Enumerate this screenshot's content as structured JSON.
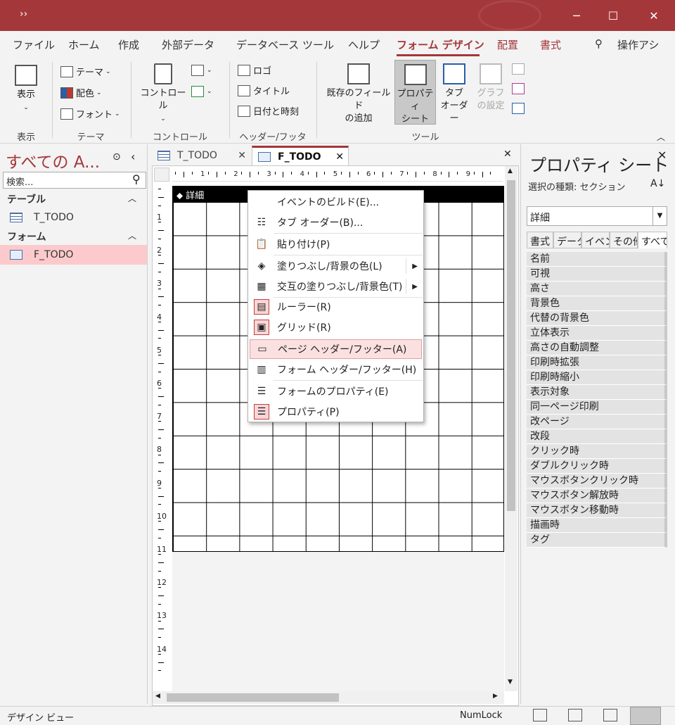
{
  "titlebar": {
    "quick_access": "››",
    "minimize": "─",
    "maximize": "☐",
    "close": "✕"
  },
  "menu": {
    "tabs": [
      "ファイル",
      "ホーム",
      "作成",
      "外部データ",
      "データベース ツール",
      "ヘルプ",
      "フォーム デザイン",
      "配置",
      "書式"
    ],
    "search_label": "操作アシ"
  },
  "ribbon": {
    "view": {
      "label": "表示",
      "group": "表示"
    },
    "theme": {
      "theme": "テーマ",
      "color": "配色",
      "font": "フォント",
      "group": "テーマ"
    },
    "controls": {
      "label": "コントロール",
      "group": "コントロール"
    },
    "header_footer": {
      "logo": "ロゴ",
      "title": "タイトル",
      "datetime": "日付と時刻",
      "group": "ヘッダー/フッター"
    },
    "tools": {
      "existing_fields_1": "既存のフィールド",
      "existing_fields_2": "の追加",
      "property_sheet_1": "プロパティ",
      "property_sheet_2": "シート",
      "tab_order_1": "タブ",
      "tab_order_2": "オーダー",
      "chart_settings_1": "グラフ",
      "chart_settings_2": "の設定",
      "group": "ツール"
    }
  },
  "nav": {
    "title": "すべての A...",
    "search_placeholder": "検索...",
    "tables_header": "テーブル",
    "tables": [
      "T_TODO"
    ],
    "forms_header": "フォーム",
    "forms": [
      "F_TODO"
    ]
  },
  "doc_tabs": [
    {
      "label": "T_TODO",
      "active": false
    },
    {
      "label": "F_TODO",
      "active": true
    }
  ],
  "design": {
    "section_label": "詳細",
    "hruler": [
      "1",
      "2",
      "3",
      "4",
      "5",
      "6",
      "7",
      "8",
      "9"
    ],
    "vruler": [
      "1",
      "2",
      "3",
      "4",
      "5",
      "6",
      "7",
      "8",
      "9",
      "10",
      "11",
      "12",
      "13",
      "14"
    ]
  },
  "context_menu": {
    "items": [
      "イベントのビルド(E)...",
      "タブ オーダー(B)...",
      "貼り付け(P)",
      "塗りつぶし/背景の色(L)",
      "交互の塗りつぶし/背景色(T)",
      "ルーラー(R)",
      "グリッド(R)",
      "ページ ヘッダー/フッター(A)",
      "フォーム ヘッダー/フッター(H)",
      "フォームのプロパティ(E)",
      "プロパティ(P)"
    ]
  },
  "property_sheet": {
    "title": "プロパティ シート",
    "selection_type": "選択の種類:  セクション",
    "selected": "詳細",
    "tabs": [
      "書式",
      "データ",
      "イベン",
      "その他",
      "すべて"
    ],
    "properties": [
      "名前",
      "可視",
      "高さ",
      "背景色",
      "代替の背景色",
      "立体表示",
      "高さの自動調整",
      "印刷時拡張",
      "印刷時縮小",
      "表示対象",
      "同一ページ印刷",
      "改ページ",
      "改段",
      "クリック時",
      "ダブルクリック時",
      "マウスボタンクリック時",
      "マウスボタン解放時",
      "マウスボタン移動時",
      "描画時",
      "タグ"
    ]
  },
  "status": {
    "view": "デザイン ビュー",
    "numlock": "NumLock"
  }
}
